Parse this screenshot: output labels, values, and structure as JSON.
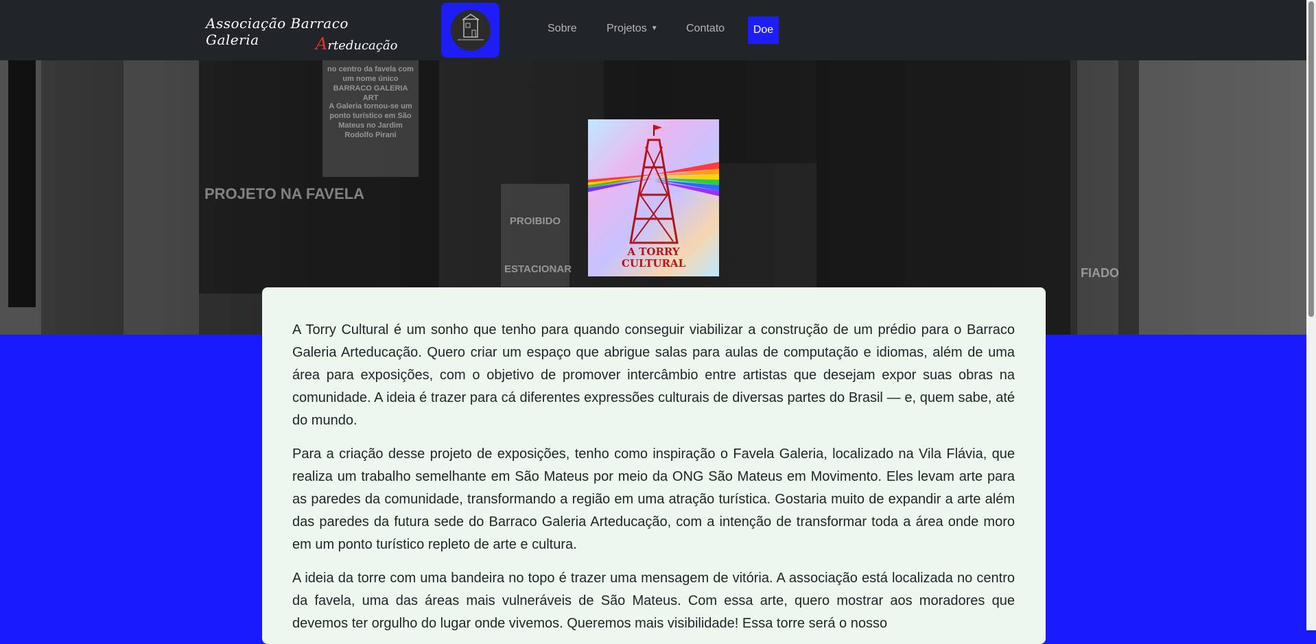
{
  "brand": {
    "name_line1": "Associação Barraco Galeria",
    "name_line2_accent": "A",
    "name_line2_rest": "rteducação"
  },
  "nav": {
    "items": [
      {
        "label": "Sobre"
      },
      {
        "label": "Projetos"
      },
      {
        "label": "Contato"
      }
    ],
    "donate_label": "Doe"
  },
  "feature": {
    "caption_line1": "A TORRY",
    "caption_line2": "CULTURAL"
  },
  "article": {
    "paragraphs": [
      "A Torry Cultural é um sonho que tenho para quando conseguir viabilizar a construção de um prédio para o Barraco Galeria Arteducação. Quero criar um espaço que abrigue salas para aulas de computação e idiomas, além de uma área para exposições, com o objetivo de promover intercâmbio entre artistas que desejam expor suas obras na comunidade. A ideia é trazer para cá diferentes expressões culturais de diversas partes do Brasil — e, quem sabe, até do mundo.",
      "Para a criação desse projeto de exposições, tenho como inspiração o Favela Galeria, localizado na Vila Flávia, que realiza um trabalho semelhante em São Mateus por meio da ONG São Mateus em Movimento. Eles levam arte para as paredes da comunidade, transformando a região em uma atração turística. Gostaria muito de expandir a arte além das paredes da futura sede do Barraco Galeria Arteducação, com a intenção de transformar toda a área onde moro em um ponto turístico repleto de arte e cultura.",
      "A ideia da torre com uma bandeira no topo é trazer uma mensagem de vitória. A associação está localizada no centro da favela, uma das áreas mais vulneráveis de São Mateus. Com essa arte, quero mostrar aos moradores que devemos ter orgulho do lugar onde vivemos. Queremos mais visibilidade! Essa torre será o nosso"
    ]
  },
  "hero_signs": {
    "sign1": "no centro da favela com um nome único BARRACO GALERIA ART",
    "sign2": "A Galeria tornou-se um ponto turístico em São Mateus no Jardim Rodolfo Pirani",
    "sign3": "PROJETO NA FAVELA",
    "sign4": "PROIBIDO ESTACIONAR",
    "sign5": "FIADO"
  },
  "colors": {
    "accent_blue": "#1d1df5",
    "navbar_bg": "#212529",
    "card_bg": "#eef7ee"
  }
}
